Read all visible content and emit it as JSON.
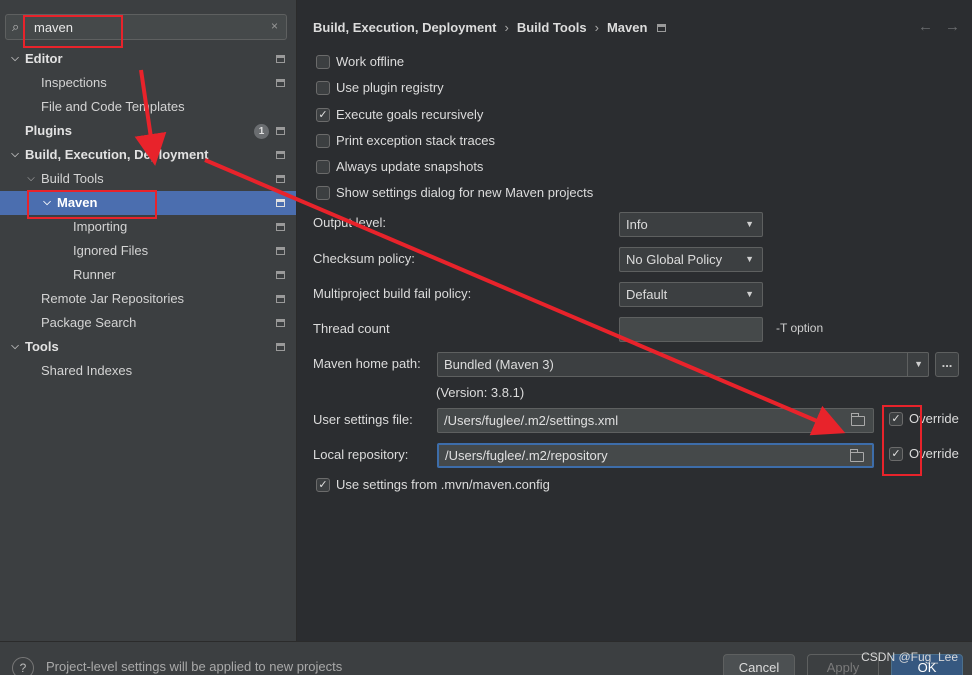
{
  "search": {
    "value": "maven",
    "clear_glyph": "×"
  },
  "tree": {
    "editor": "Editor",
    "inspections": "Inspections",
    "file_templates": "File and Code Templates",
    "plugins": "Plugins",
    "plugins_badge": "1",
    "build": "Build, Execution, Deployment",
    "build_tools": "Build Tools",
    "maven": "Maven",
    "importing": "Importing",
    "ignored_files": "Ignored Files",
    "runner": "Runner",
    "remote_jar": "Remote Jar Repositories",
    "package_search": "Package Search",
    "tools": "Tools",
    "shared_indexes": "Shared Indexes"
  },
  "breadcrumb": {
    "part1": "Build, Execution, Deployment",
    "part2": "Build Tools",
    "part3": "Maven",
    "sep": "›"
  },
  "nav": {
    "back": "←",
    "forward": "→"
  },
  "options": {
    "work_offline": "Work offline",
    "plugin_registry": "Use plugin registry",
    "execute_recursive": "Execute goals recursively",
    "print_stack": "Print exception stack traces",
    "update_snapshots": "Always update snapshots",
    "show_dialog": "Show settings dialog for new Maven projects",
    "use_mvn_config": "Use settings from .mvn/maven.config",
    "check_glyph": "✓"
  },
  "fields": {
    "output_level_label": "Output level:",
    "output_level_value": "Info",
    "checksum_label": "Checksum policy:",
    "checksum_value": "No Global Policy",
    "fail_policy_label": "Multiproject build fail policy:",
    "fail_policy_value": "Default",
    "thread_count_label": "Thread count",
    "thread_count_value": "",
    "t_option": "-T option",
    "home_label": "Maven home path:",
    "home_value": "Bundled (Maven 3)",
    "home_browse": "...",
    "version": "(Version: 3.8.1)",
    "user_settings_label": "User settings file:",
    "user_settings_value": "/Users/fuglee/.m2/settings.xml",
    "local_repo_label": "Local repository:",
    "local_repo_value": "/Users/fuglee/.m2/repository",
    "override1": "Override",
    "override2": "Override"
  },
  "footer": {
    "help": "?",
    "text": "Project-level settings will be applied to new projects",
    "cancel": "Cancel",
    "apply": "Apply",
    "ok": "OK"
  },
  "watermark": "CSDN @Fug_Lee",
  "colors": {
    "selection": "#4b6eaf",
    "annotation": "#e8232b",
    "primary": "#365880"
  },
  "icons": [
    "search-icon",
    "chevron-down-icon",
    "chevron-right-icon",
    "settings-page-icon",
    "folder-icon",
    "help-icon"
  ]
}
